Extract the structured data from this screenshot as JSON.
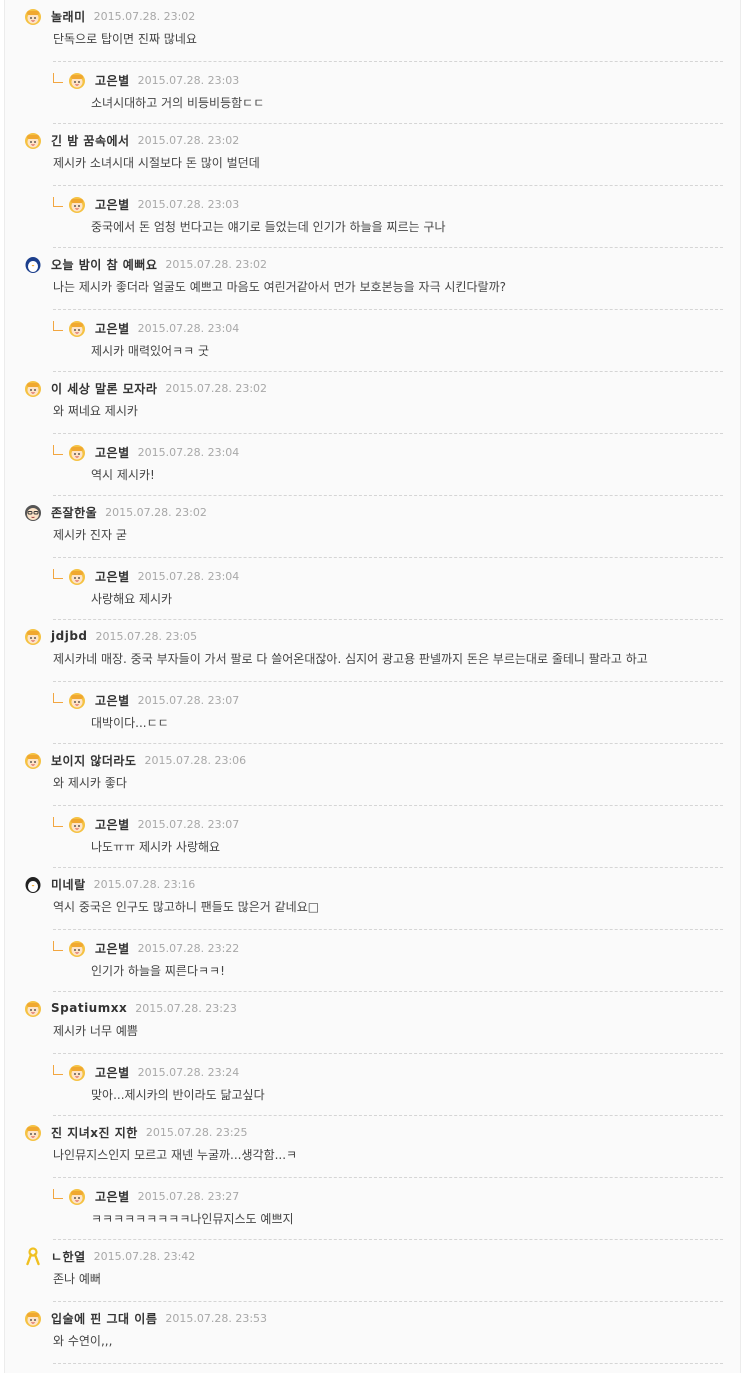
{
  "comments": [
    {
      "type": "top",
      "nick": "놀래미",
      "date": "2015.07.28. 23:02",
      "text": "단독으로 탑이면 진짜 많네요",
      "avatar": "girl"
    },
    {
      "type": "reply",
      "nick": "고은별",
      "date": "2015.07.28. 23:03",
      "text": "소녀시대하고 거의 비등비등함ㄷㄷ",
      "avatar": "girl"
    },
    {
      "type": "top",
      "nick": "긴 밤 꿈속에서",
      "date": "2015.07.28. 23:02",
      "text": "제시카 소녀시대 시절보다 돈 많이 벌던데",
      "avatar": "girl"
    },
    {
      "type": "reply",
      "nick": "고은별",
      "date": "2015.07.28. 23:03",
      "text": "중국에서 돈 엄청 번다고는 얘기로 들었는데 인기가 하늘을 찌르는 구나",
      "avatar": "girl"
    },
    {
      "type": "top",
      "nick": "오늘 밤이 참 예뻐요",
      "date": "2015.07.28. 23:02",
      "text": "나는 제시카 좋더라 얼굴도 예쁘고 마음도 여린거같아서 먼가 보호본능을 자극 시킨다랄까?",
      "avatar": "penguin-blue"
    },
    {
      "type": "reply",
      "nick": "고은별",
      "date": "2015.07.28. 23:04",
      "text": "제시카 매력있어ㅋㅋ 굿",
      "avatar": "girl"
    },
    {
      "type": "top",
      "nick": "이 세상 말론 모자라",
      "date": "2015.07.28. 23:02",
      "text": "와 쩌네요 제시카",
      "avatar": "girl"
    },
    {
      "type": "reply",
      "nick": "고은별",
      "date": "2015.07.28. 23:04",
      "text": "역시 제시카!",
      "avatar": "girl"
    },
    {
      "type": "top",
      "nick": "존잘한울",
      "date": "2015.07.28. 23:02",
      "text": "제시카 진자 굳",
      "avatar": "man"
    },
    {
      "type": "reply",
      "nick": "고은별",
      "date": "2015.07.28. 23:04",
      "text": "사랑해요 제시카",
      "avatar": "girl"
    },
    {
      "type": "top",
      "nick": "jdjbd",
      "date": "2015.07.28. 23:05",
      "text": "제시카네 매장. 중국 부자들이 가서 팔로 다 쓸어온대잖아. 심지어 광고용 판넬까지 돈은 부르는대로 줄테니 팔라고 하고",
      "avatar": "girl"
    },
    {
      "type": "reply",
      "nick": "고은별",
      "date": "2015.07.28. 23:07",
      "text": "대박이다...ㄷㄷ",
      "avatar": "girl"
    },
    {
      "type": "top",
      "nick": "보이지 않더라도",
      "date": "2015.07.28. 23:06",
      "text": "와 제시카 좋다",
      "avatar": "girl"
    },
    {
      "type": "reply",
      "nick": "고은별",
      "date": "2015.07.28. 23:07",
      "text": "나도ㅠㅠ 제시카 사랑해요",
      "avatar": "girl"
    },
    {
      "type": "top",
      "nick": "미네랄",
      "date": "2015.07.28. 23:16",
      "text": "역시 중국은 인구도 많고하니 팬들도 많은거 같네요□",
      "avatar": "penguin"
    },
    {
      "type": "reply",
      "nick": "고은별",
      "date": "2015.07.28. 23:22",
      "text": "인기가 하늘을 찌른다ㅋㅋ!",
      "avatar": "girl"
    },
    {
      "type": "top",
      "nick": "Spatiumxx",
      "date": "2015.07.28. 23:23",
      "text": "제시카 너무 예쁨",
      "avatar": "girl"
    },
    {
      "type": "reply",
      "nick": "고은별",
      "date": "2015.07.28. 23:24",
      "text": "맞아...제시카의 반이라도 닮고싶다",
      "avatar": "girl"
    },
    {
      "type": "top",
      "nick": "진 지녀x진 지한",
      "date": "2015.07.28. 23:25",
      "text": "나인뮤지스인지 모르고 재넨 누굴까...생각함...ㅋ",
      "avatar": "girl"
    },
    {
      "type": "reply",
      "nick": "고은별",
      "date": "2015.07.28. 23:27",
      "text": "ㅋㅋㅋㅋㅋㅋㅋㅋㅋ나인뮤지스도 예쁘지",
      "avatar": "girl"
    },
    {
      "type": "top",
      "nick": "ㄴ한열",
      "date": "2015.07.28. 23:42",
      "text": "존나 예뻐",
      "avatar": "ribbon"
    },
    {
      "type": "top",
      "nick": "입술에 핀 그대 이름",
      "date": "2015.07.28. 23:53",
      "text": "와 수연이,,,",
      "avatar": "girl"
    }
  ],
  "colors": {
    "reply_mark": "#f2a640",
    "date": "#a8a8a8",
    "nick": "#333333"
  }
}
